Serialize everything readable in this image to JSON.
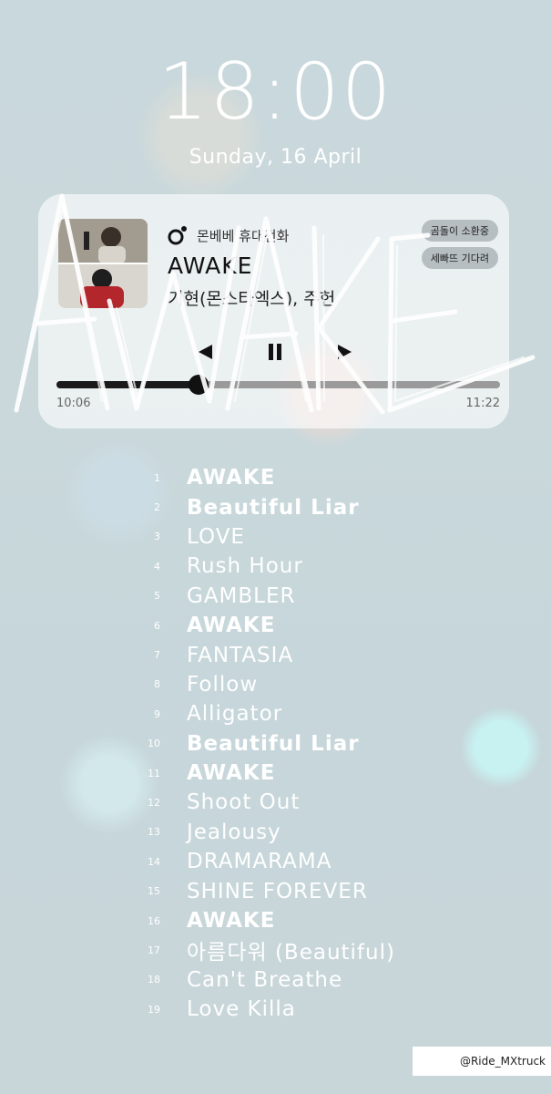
{
  "lockscreen": {
    "time": "18:00",
    "date": "Sunday, 16 April"
  },
  "player": {
    "app_name": "몬베베 휴대전화",
    "song_title": "AWAKE",
    "artist": "기현(몬스타엑스), 주헌",
    "chips": [
      "곰돌이 소환중",
      "세빠뜨 기다려"
    ],
    "elapsed": "10:06",
    "total": "11:22",
    "progress": 0.32,
    "background_script_text": "AWAKE",
    "icons": {
      "app": "music-note-icon",
      "prev": "previous-icon",
      "pause": "pause-icon",
      "next": "next-icon"
    }
  },
  "tracklist": [
    {
      "num": "1",
      "title": "AWAKE",
      "bold": true
    },
    {
      "num": "2",
      "title": "Beautiful Liar",
      "bold": true
    },
    {
      "num": "3",
      "title": "LOVE",
      "bold": false
    },
    {
      "num": "4",
      "title": "Rush Hour",
      "bold": false
    },
    {
      "num": "5",
      "title": "GAMBLER",
      "bold": false
    },
    {
      "num": "6",
      "title": "AWAKE",
      "bold": true
    },
    {
      "num": "7",
      "title": "FANTASIA",
      "bold": false
    },
    {
      "num": "8",
      "title": "Follow",
      "bold": false
    },
    {
      "num": "9",
      "title": "Alligator",
      "bold": false
    },
    {
      "num": "10",
      "title": "Beautiful Liar",
      "bold": true
    },
    {
      "num": "11",
      "title": "AWAKE",
      "bold": true
    },
    {
      "num": "12",
      "title": "Shoot Out",
      "bold": false
    },
    {
      "num": "13",
      "title": "Jealousy",
      "bold": false
    },
    {
      "num": "14",
      "title": "DRAMARAMA",
      "bold": false
    },
    {
      "num": "15",
      "title": "SHINE FOREVER",
      "bold": false
    },
    {
      "num": "16",
      "title": "AWAKE",
      "bold": true
    },
    {
      "num": "17",
      "title": "아름다워 (Beautiful)",
      "bold": false
    },
    {
      "num": "18",
      "title": "Can't Breathe",
      "bold": false
    },
    {
      "num": "19",
      "title": "Love Killa",
      "bold": false
    }
  ],
  "credit": "@Ride_MXtruck",
  "colors": {
    "text_white": "#ffffff",
    "progress_fill": "#1a1a1a",
    "progress_track": "#9a9a9a"
  }
}
